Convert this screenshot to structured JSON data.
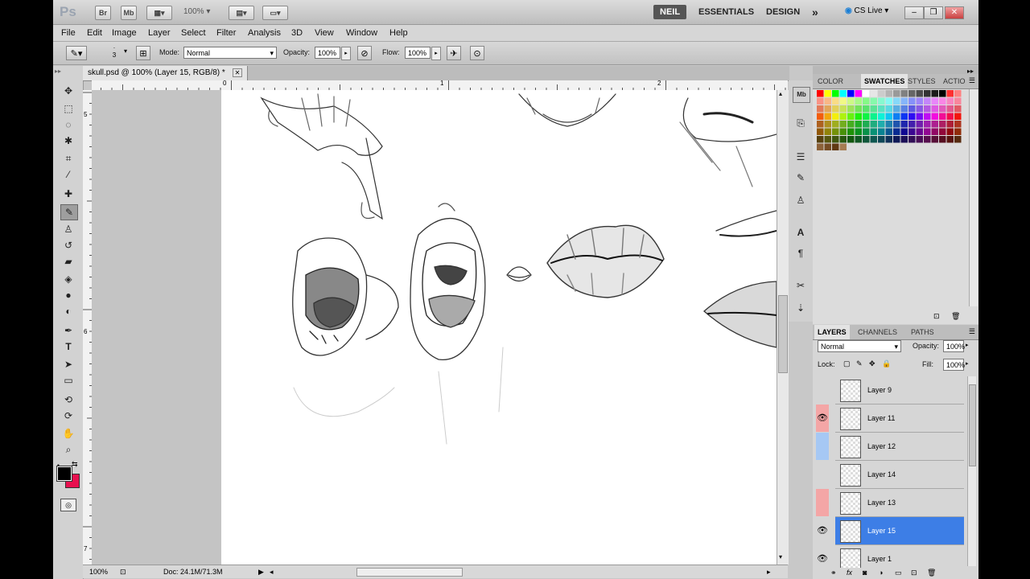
{
  "app": {
    "logo": "Ps",
    "bridge_label": "Br",
    "minibridge_label": "Mb",
    "zoom_value": "100%",
    "workspaces": [
      "NEIL",
      "ESSENTIALS",
      "DESIGN"
    ],
    "more_symbol": "»",
    "cslive_label": "CS Live",
    "window_controls": [
      "–",
      "❐",
      "✕"
    ]
  },
  "menu": [
    "File",
    "Edit",
    "Image",
    "Layer",
    "Select",
    "Filter",
    "Analysis",
    "3D",
    "View",
    "Window",
    "Help"
  ],
  "options": {
    "brush_size": "3",
    "mode_label": "Mode:",
    "mode_value": "Normal",
    "opacity_label": "Opacity:",
    "opacity_value": "100%",
    "flow_label": "Flow:",
    "flow_value": "100%"
  },
  "document": {
    "tab_title": "skull.psd @ 100% (Layer 15, RGB/8) *",
    "ruler_top": [
      "0",
      "1",
      "2"
    ],
    "ruler_left": [
      "5",
      "6",
      "7"
    ],
    "zoom": "100%",
    "doc_size": "Doc: 24.1M/71.3M"
  },
  "panels": {
    "color_tabs": [
      "COLOR",
      "SWATCHES",
      "STYLES",
      "ACTIO"
    ],
    "layer_tabs": [
      "LAYERS",
      "CHANNELS",
      "PATHS"
    ],
    "blend_mode": "Normal",
    "opacity_label": "Opacity:",
    "opacity_value": "100%",
    "lock_label": "Lock:",
    "fill_label": "Fill:",
    "fill_value": "100%",
    "layers": [
      {
        "name": "Layer 9",
        "visible": false,
        "tag_color": "",
        "selected": false
      },
      {
        "name": "Layer 11",
        "visible": true,
        "tag_color": "#f4a6a6",
        "selected": false
      },
      {
        "name": "Layer 12",
        "visible": false,
        "tag_color": "#a6c8f4",
        "selected": false
      },
      {
        "name": "Layer 14",
        "visible": false,
        "tag_color": "",
        "selected": false
      },
      {
        "name": "Layer 13",
        "visible": false,
        "tag_color": "#f4a6a6",
        "selected": false
      },
      {
        "name": "Layer 15",
        "visible": true,
        "tag_color": "",
        "selected": true
      },
      {
        "name": "Layer 1",
        "visible": true,
        "tag_color": "",
        "selected": false
      }
    ]
  },
  "colors": {
    "foreground": "#000000",
    "background": "#e8104f",
    "selection": "#3d7ee6"
  }
}
